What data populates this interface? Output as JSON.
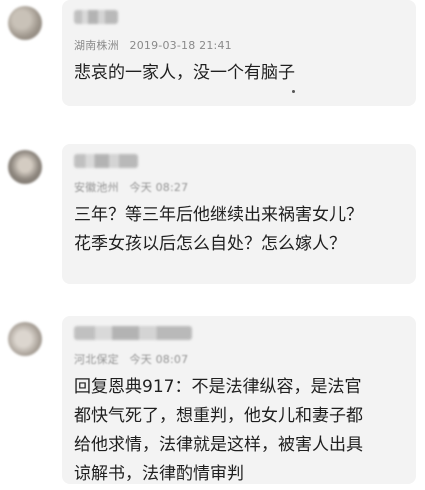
{
  "comments": [
    {
      "location": "湖南株洲",
      "time": "2019-03-18 21:41",
      "lines": [
        "悲哀的一家人，没一个有脑子"
      ]
    },
    {
      "location": "安徽池州",
      "time": "今天 08:27",
      "lines": [
        "三年？等三年后他继续出来祸害女儿？",
        "花季女孩以后怎么自处？怎么嫁人？"
      ]
    },
    {
      "location": "河北保定",
      "time": "今天 08:07",
      "lines": [
        "回复恩典917：不是法律纵容，是法官",
        "都快气死了，想重判，他女儿和妻子都",
        "给他求情，法律就是这样，被害人出具",
        "谅解书，法律酌情审判"
      ]
    }
  ]
}
